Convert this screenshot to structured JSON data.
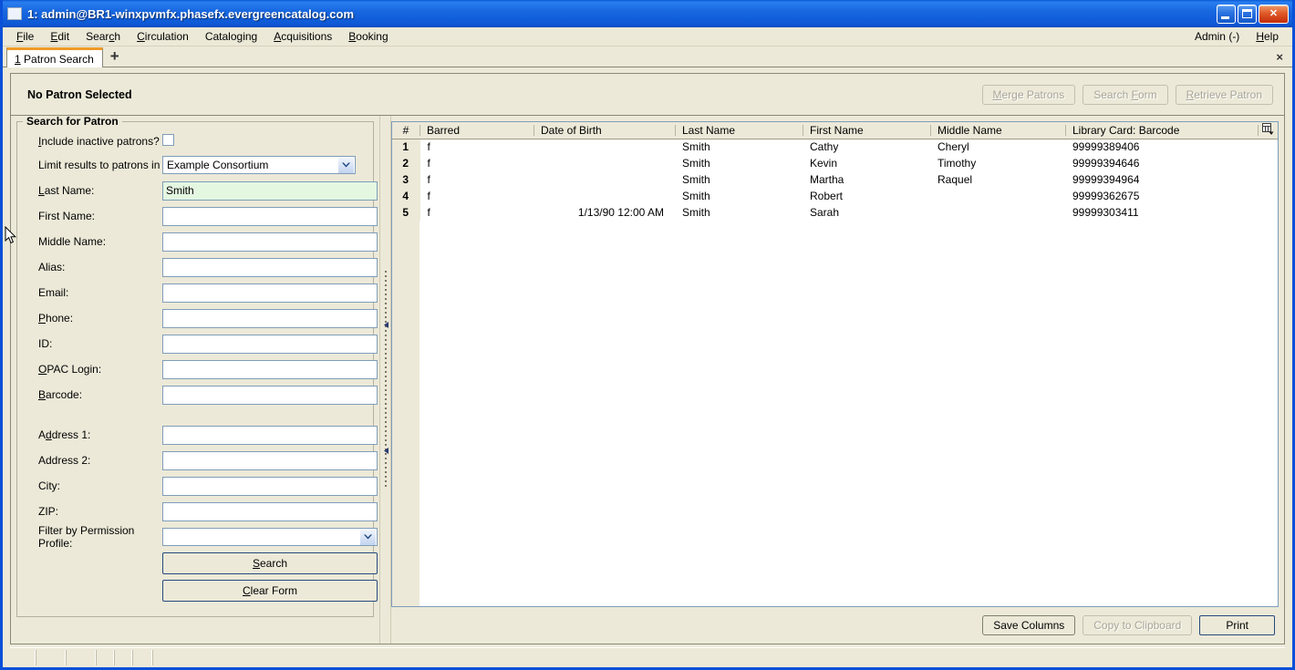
{
  "window": {
    "title": "1: admin@BR1-winxpvmfx.phasefx.evergreencatalog.com",
    "minimize_label": "Minimize",
    "maximize_label": "Maximize",
    "close_label": "Close"
  },
  "menubar": {
    "items": [
      {
        "label": "File",
        "accel": "F"
      },
      {
        "label": "Edit",
        "accel": "E"
      },
      {
        "label": "Search",
        "accel": "c"
      },
      {
        "label": "Circulation",
        "accel": "C"
      },
      {
        "label": "Cataloging",
        "accel": "g"
      },
      {
        "label": "Acquisitions",
        "accel": "A"
      },
      {
        "label": "Booking",
        "accel": "B"
      }
    ],
    "admin_label": "Admin (-)",
    "help_label": "Help"
  },
  "tabs": {
    "items": [
      {
        "number": "1",
        "label": "Patron Search"
      }
    ],
    "add_label": "+",
    "close_label": "×"
  },
  "patron_bar": {
    "title": "No Patron Selected",
    "buttons": [
      {
        "label": "Merge Patrons",
        "name": "merge-patrons-button",
        "disabled": true
      },
      {
        "label": "Search Form",
        "name": "search-form-button",
        "disabled": true
      },
      {
        "label": "Retrieve Patron",
        "name": "retrieve-patron-button",
        "disabled": true
      }
    ]
  },
  "search_form": {
    "legend": "Search for Patron",
    "include_inactive_label": "Include inactive patrons?",
    "include_inactive_checked": false,
    "limit_results_label": "Limit results to patrons in",
    "limit_results_value": "Example Consortium",
    "fields": [
      {
        "label": "Last Name:",
        "value": "Smith",
        "focused": true,
        "name": "last-name-field"
      },
      {
        "label": "First Name:",
        "value": "",
        "focused": false,
        "name": "first-name-field"
      },
      {
        "label": "Middle Name:",
        "value": "",
        "focused": false,
        "name": "middle-name-field"
      },
      {
        "label": "Alias:",
        "value": "",
        "focused": false,
        "name": "alias-field"
      },
      {
        "label": "Email:",
        "value": "",
        "focused": false,
        "name": "email-field"
      },
      {
        "label": "Phone:",
        "value": "",
        "focused": false,
        "name": "phone-field"
      },
      {
        "label": "ID:",
        "value": "",
        "focused": false,
        "name": "id-field"
      },
      {
        "label": "OPAC Login:",
        "value": "",
        "focused": false,
        "name": "opac-login-field"
      },
      {
        "label": "Barcode:",
        "value": "",
        "focused": false,
        "name": "barcode-field"
      }
    ],
    "address_fields": [
      {
        "label": "Address 1:",
        "value": "",
        "name": "address1-field"
      },
      {
        "label": "Address 2:",
        "value": "",
        "name": "address2-field"
      },
      {
        "label": "City:",
        "value": "",
        "name": "city-field"
      },
      {
        "label": "ZIP:",
        "value": "",
        "name": "zip-field"
      }
    ],
    "permission_profile_label": "Filter by Permission Profile:",
    "permission_profile_value": "",
    "search_button": "Search",
    "clear_button": "Clear Form"
  },
  "results": {
    "columns": [
      "#",
      "Barred",
      "Date of Birth",
      "Last Name",
      "First Name",
      "Middle Name",
      "Library Card: Barcode"
    ],
    "rows": [
      {
        "num": "1",
        "barred": "f",
        "dob": "",
        "last": "Smith",
        "first": "Cathy",
        "middle": "Cheryl",
        "barcode": "99999389406"
      },
      {
        "num": "2",
        "barred": "f",
        "dob": "",
        "last": "Smith",
        "first": "Kevin",
        "middle": "Timothy",
        "barcode": "99999394646"
      },
      {
        "num": "3",
        "barred": "f",
        "dob": "",
        "last": "Smith",
        "first": "Martha",
        "middle": "Raquel",
        "barcode": "99999394964"
      },
      {
        "num": "4",
        "barred": "f",
        "dob": "",
        "last": "Smith",
        "first": "Robert",
        "middle": "",
        "barcode": "99999362675"
      },
      {
        "num": "5",
        "barred": "f",
        "dob": "1/13/90 12:00 AM",
        "last": "Smith",
        "first": "Sarah",
        "middle": "",
        "barcode": "99999303411"
      }
    ],
    "column_picker_name": "column-picker-icon",
    "footer_buttons": [
      {
        "label": "Save Columns",
        "name": "save-columns-button",
        "disabled": false,
        "default": false
      },
      {
        "label": "Copy to Clipboard",
        "name": "copy-to-clipboard-button",
        "disabled": true,
        "default": false
      },
      {
        "label": "Print",
        "name": "print-button",
        "disabled": false,
        "default": true
      }
    ]
  },
  "colors": {
    "window_chrome": "#ece9d8",
    "title_blue": "#0a5ce8",
    "tab_accent": "#f09a28",
    "focused_field": "#e4f7e1",
    "field_border": "#7f9db9"
  }
}
